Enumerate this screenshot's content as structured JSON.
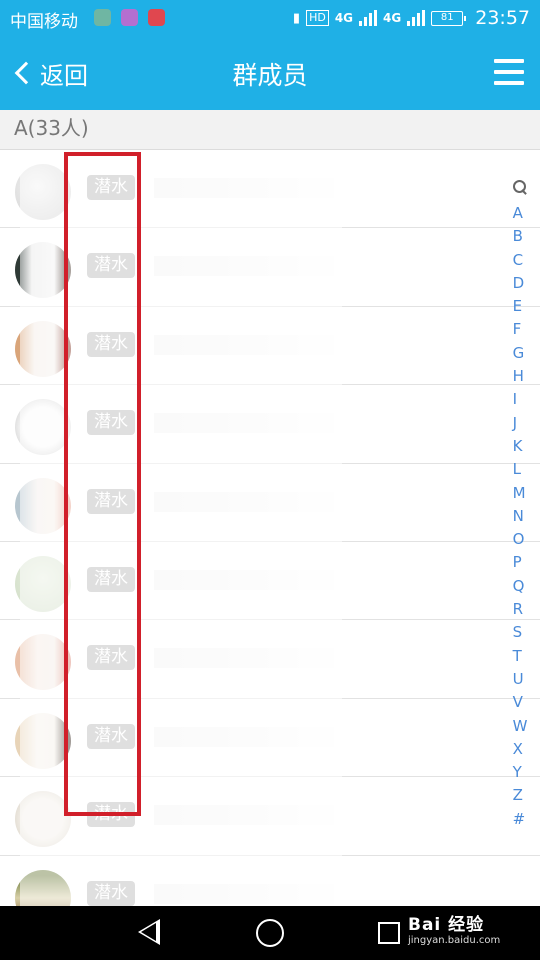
{
  "status_bar": {
    "carrier": "中国移动",
    "network": "4G",
    "network2": "4G",
    "hd": "HD",
    "battery": "81",
    "time": "23:57"
  },
  "header": {
    "back_label": "返回",
    "title": "群成员"
  },
  "section": {
    "header": "A(33人)"
  },
  "members": [
    {
      "tag": "潜水"
    },
    {
      "tag": "潜水"
    },
    {
      "tag": "潜水"
    },
    {
      "tag": "潜水"
    },
    {
      "tag": "潜水"
    },
    {
      "tag": "潜水"
    },
    {
      "tag": "潜水"
    },
    {
      "tag": "潜水"
    },
    {
      "tag": "潜水"
    },
    {
      "tag": "潜水"
    }
  ],
  "index": {
    "letters": [
      "A",
      "B",
      "C",
      "D",
      "E",
      "F",
      "G",
      "H",
      "I",
      "J",
      "K",
      "L",
      "M",
      "N",
      "O",
      "P",
      "Q",
      "R",
      "S",
      "T",
      "U",
      "V",
      "W",
      "X",
      "Y",
      "Z",
      "#"
    ]
  },
  "watermark": {
    "brand": "Bai 经验",
    "url": "jingyan.baidu.com"
  },
  "colors": {
    "accent": "#1fb0e6",
    "annotation": "#d11f2a",
    "tag": "#b8b8b8",
    "index": "#4a8ad8"
  }
}
